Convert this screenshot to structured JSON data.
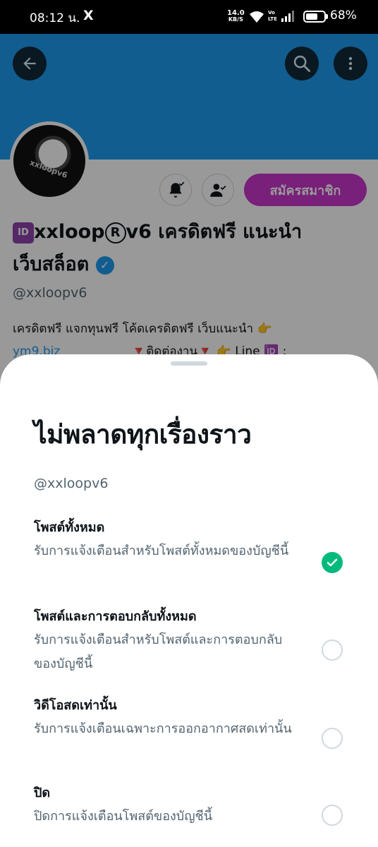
{
  "status_bar": {
    "time": "08:12 น.",
    "x_icon": "X",
    "speed_value": "14.0",
    "speed_unit": "KB/S",
    "volte_top": "Vo",
    "volte_bottom": "LTE",
    "battery_level_percent": 68,
    "battery_text": "68%"
  },
  "profile": {
    "banner_color": "#1d9bf0",
    "back_icon": "arrow-left-icon",
    "search_icon": "search-icon",
    "more_icon": "more-vertical-icon",
    "avatar_text": "xxloopv6",
    "bell_icon": "bell-check-icon",
    "follow_icon": "person-check-icon",
    "subscribe_label": "สมัครสมาชิก",
    "subscribe_color": "#c936cc",
    "name_badge": "ID",
    "name_part1": "xxloop",
    "name_reg": "R",
    "name_part2": "v6 เครดิตฟรี แนะนำ",
    "name_line2": "เว็บสล็อต",
    "verified_icon": "verified-badge-icon",
    "handle": "@xxloopv6",
    "bio_line1": "เครดิตฟรี แจกทุนฟรี โค้ดเครดิตฟรี เว็บแนะนำ 👉",
    "bio_link": "ym9.biz",
    "bio_line2_rest": "🔻ติดต่องาน🔻 👉 Line 🆔 :"
  },
  "sheet": {
    "title": "ไม่พลาดทุกเรื่องราว",
    "handle": "@xxloopv6",
    "options": [
      {
        "title": "โพสต์ทั้งหมด",
        "description": "รับการแจ้งเตือนสำหรับโพสต์ทั้งหมดของบัญชีนี้",
        "selected": true
      },
      {
        "title": "โพสต์และการตอบกลับทั้งหมด",
        "description": "รับการแจ้งเตือนสำหรับโพสต์และการตอบกลับของบัญชีนี้",
        "selected": false
      },
      {
        "title": "วิดีโอสดเท่านั้น",
        "description": "รับการแจ้งเตือนเฉพาะการออกอากาศสดเท่านั้น",
        "selected": false
      },
      {
        "title": "ปิด",
        "description": "ปิดการแจ้งเตือนโพสต์ของบัญชีนี้",
        "selected": false
      }
    ],
    "selected_color": "#00ba7c"
  }
}
